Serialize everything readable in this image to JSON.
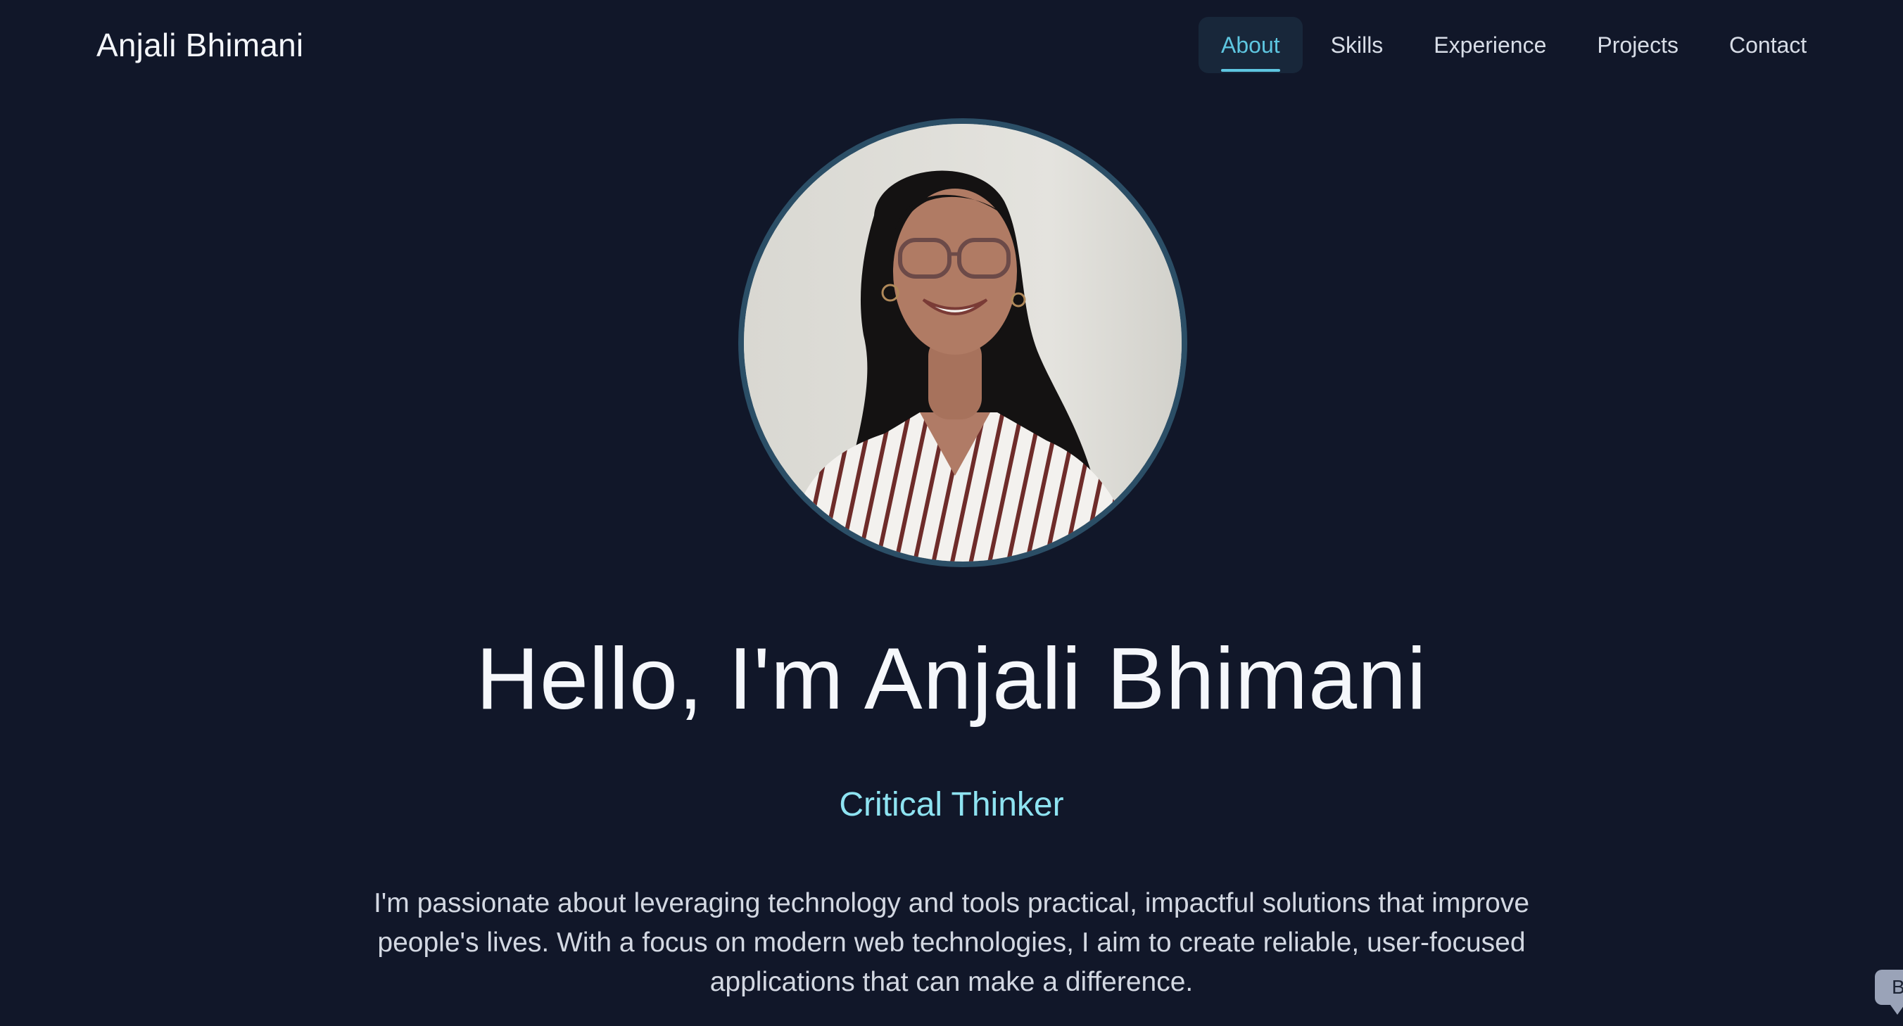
{
  "header": {
    "brand": "Anjali Bhimani",
    "nav": [
      {
        "label": "About",
        "active": true
      },
      {
        "label": "Skills",
        "active": false
      },
      {
        "label": "Experience",
        "active": false
      },
      {
        "label": "Projects",
        "active": false
      },
      {
        "label": "Contact",
        "active": false
      }
    ]
  },
  "hero": {
    "headline": "Hello, I'm Anjali Bhimani",
    "tagline": "Critical Thinker",
    "intro": "I'm passionate about leveraging technology and tools practical, impactful solutions that improve people's lives. With a focus on modern web technologies, I aim to create reliable, user-focused applications that can make a difference."
  },
  "floating_badge": {
    "text": "B"
  },
  "colors": {
    "background": "#111729",
    "accent": "#5ec6e0",
    "tagline": "#8ee3f1",
    "avatar_ring": "#2b4e66"
  }
}
